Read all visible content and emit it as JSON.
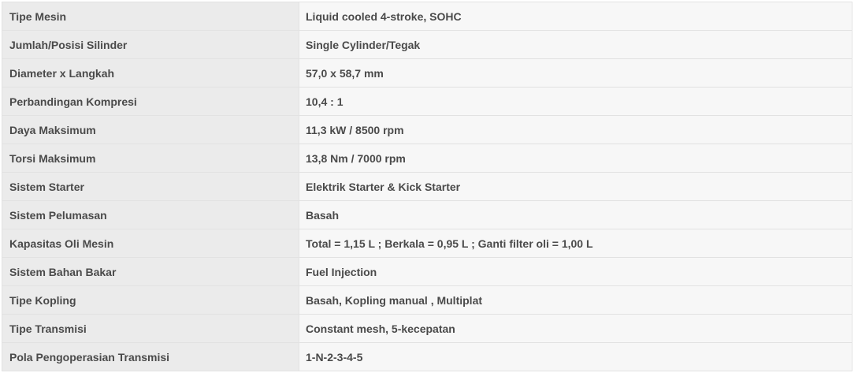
{
  "specs": [
    {
      "label": "Tipe Mesin",
      "value": "Liquid cooled 4-stroke, SOHC"
    },
    {
      "label": "Jumlah/Posisi Silinder",
      "value": "Single Cylinder/Tegak"
    },
    {
      "label": "Diameter x Langkah",
      "value": "57,0 x 58,7 mm"
    },
    {
      "label": "Perbandingan Kompresi",
      "value": "10,4 : 1"
    },
    {
      "label": "Daya Maksimum",
      "value": "11,3 kW / 8500 rpm"
    },
    {
      "label": "Torsi Maksimum",
      "value": "13,8 Nm / 7000 rpm"
    },
    {
      "label": "Sistem Starter",
      "value": "Elektrik Starter & Kick Starter"
    },
    {
      "label": "Sistem Pelumasan",
      "value": "Basah"
    },
    {
      "label": "Kapasitas Oli Mesin",
      "value": "Total = 1,15 L ; Berkala = 0,95 L ; Ganti filter oli = 1,00 L"
    },
    {
      "label": "Sistem Bahan Bakar",
      "value": "Fuel Injection"
    },
    {
      "label": "Tipe Kopling",
      "value": "Basah, Kopling manual , Multiplat"
    },
    {
      "label": "Tipe Transmisi",
      "value": "Constant mesh, 5-kecepatan"
    },
    {
      "label": "Pola Pengoperasian Transmisi",
      "value": "1-N-2-3-4-5"
    }
  ]
}
